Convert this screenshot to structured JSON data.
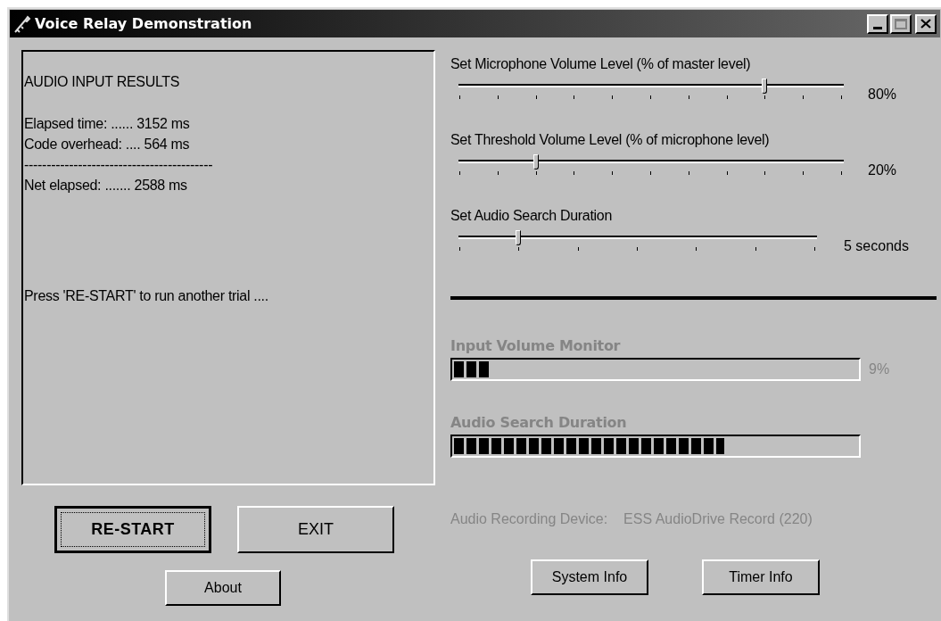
{
  "window": {
    "title": "Voice Relay Demonstration"
  },
  "results": [
    {
      "kind": "heading",
      "text": "AUDIO INPUT RESULTS"
    },
    {
      "kind": "text",
      "text": "Elapsed time: ...... 3152 ms"
    },
    {
      "kind": "text",
      "text": "Code overhead: .... 564 ms"
    },
    {
      "kind": "text",
      "text": "------------------------------------------"
    },
    {
      "kind": "text",
      "text": "Net elapsed: ....... 2588 ms"
    },
    {
      "kind": "prompt",
      "text": "Press 'RE-START' to run another trial ...."
    }
  ],
  "left_buttons": [
    {
      "label": "RE-START",
      "default": true
    },
    {
      "label": "EXIT",
      "default": false
    }
  ],
  "about_button": {
    "label": "About"
  },
  "sliders": [
    {
      "label": "Set Microphone Volume Level (% of master level)",
      "level": 0.8,
      "reading": "80%"
    },
    {
      "label": "Set Threshold Volume Level (% of microphone level)",
      "level": 0.2,
      "reading": "20%"
    },
    {
      "label": "Set Audio Search Duration",
      "level": 0.167,
      "reading": "5 seconds"
    }
  ],
  "meters": [
    {
      "label": "Input Volume Monitor",
      "level": 0.09,
      "reading": "9%"
    },
    {
      "label": "Audio Search Duration",
      "level": 0.67
    }
  ],
  "device": {
    "label": "Audio Recording Device:",
    "value": "ESS AudioDrive Record (220)"
  },
  "bottom_buttons": [
    {
      "label": "System Info"
    },
    {
      "label": "Timer Info"
    }
  ]
}
